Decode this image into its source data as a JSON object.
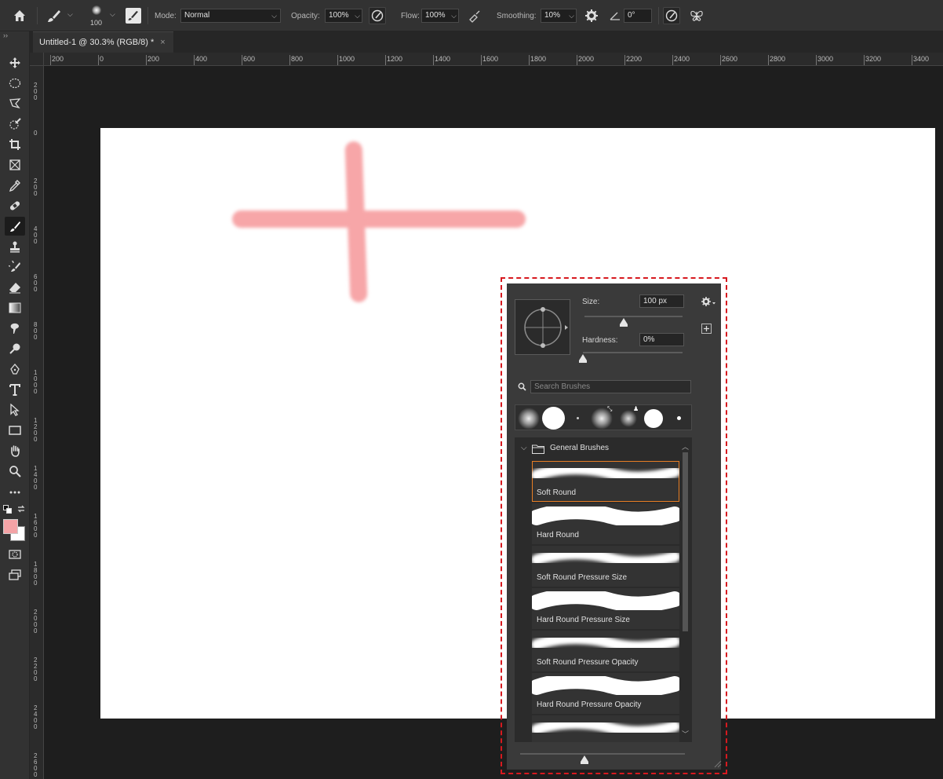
{
  "options_bar": {
    "brush_size": "100",
    "mode_label": "Mode:",
    "mode_value": "Normal",
    "opacity_label": "Opacity:",
    "opacity_value": "100%",
    "flow_label": "Flow:",
    "flow_value": "100%",
    "smoothing_label": "Smoothing:",
    "smoothing_value": "10%",
    "angle_value": "0°"
  },
  "document": {
    "tab_title": "Untitled-1 @ 30.3% (RGB/8) *",
    "close_glyph": "×"
  },
  "ruler": {
    "h_labels": [
      "200",
      "0",
      "200",
      "400",
      "600",
      "800",
      "1000",
      "1200",
      "1400",
      "1600",
      "1800",
      "2000",
      "2200",
      "2400",
      "2600",
      "2800",
      "3000",
      "3200",
      "3400"
    ],
    "v_labels": [
      "200",
      "0",
      "200",
      "400",
      "600",
      "800",
      "1000",
      "1200",
      "1400",
      "1600",
      "1800",
      "2000",
      "2200",
      "2400",
      "2600"
    ]
  },
  "brush_picker": {
    "size_label": "Size:",
    "size_value": "100 px",
    "hardness_label": "Hardness:",
    "hardness_value": "0%",
    "size_level": 0.4,
    "hardness_level": 0.0,
    "search_placeholder": "Search Brushes",
    "group_name": "General Brushes",
    "brushes": [
      {
        "name": "Soft Round",
        "style": "soft",
        "selected": true
      },
      {
        "name": "Hard Round",
        "style": "hard",
        "selected": false
      },
      {
        "name": "Soft Round Pressure Size",
        "style": "soft",
        "selected": false
      },
      {
        "name": "Hard Round Pressure Size",
        "style": "hard",
        "selected": false
      },
      {
        "name": "Soft Round Pressure Opacity",
        "style": "soft",
        "selected": false
      },
      {
        "name": "Hard Round Pressure Opacity",
        "style": "hard",
        "selected": false
      },
      {
        "name": "",
        "style": "soft",
        "selected": false
      }
    ]
  },
  "colors": {
    "foreground": "#f4a3a6",
    "background": "#ffffff",
    "selection_outline": "#d7191f",
    "selected_brush_outline": "#e87e24"
  },
  "tools": [
    "move-tool",
    "elliptical-marquee-tool",
    "polygonal-lasso-tool",
    "quick-selection-tool",
    "crop-tool",
    "frame-tool",
    "eyedropper-tool",
    "healing-brush-tool",
    "brush-tool",
    "clone-stamp-tool",
    "history-brush-tool",
    "eraser-tool",
    "gradient-tool",
    "smudge-tool",
    "dodge-tool",
    "pen-tool",
    "type-tool",
    "path-selection-tool",
    "rectangle-tool",
    "hand-tool",
    "zoom-tool",
    "more-tools"
  ]
}
